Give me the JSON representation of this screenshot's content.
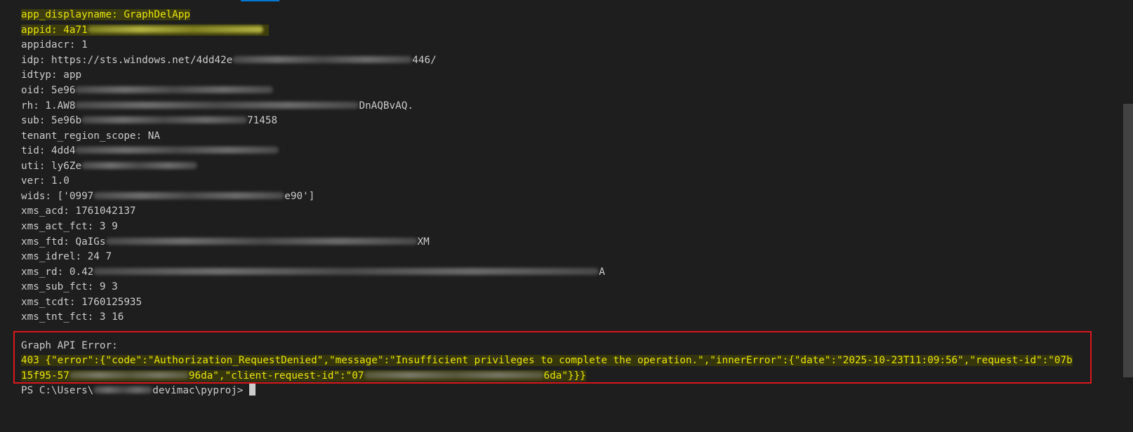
{
  "terminal": {
    "token_lines": [
      {
        "prefix": "app_displayname: GraphDelApp",
        "suffix": "",
        "highlight": true
      },
      {
        "prefix": "appid: 4a71",
        "suffix": "",
        "highlight": true
      },
      {
        "prefix": "appidacr: 1",
        "suffix": "",
        "highlight": false
      },
      {
        "prefix": "idp: https://sts.windows.net/4dd42e",
        "suffix": "446/",
        "highlight": false
      },
      {
        "prefix": "idtyp: app",
        "suffix": "",
        "highlight": false
      },
      {
        "prefix": "oid: 5e96",
        "suffix": "",
        "highlight": false
      },
      {
        "prefix": "rh: 1.AW8",
        "suffix": "DnAQBvAQ.",
        "highlight": false
      },
      {
        "prefix": "sub: 5e96b",
        "suffix": "71458",
        "highlight": false
      },
      {
        "prefix": "tenant_region_scope: NA",
        "suffix": "",
        "highlight": false
      },
      {
        "prefix": "tid: 4dd4",
        "suffix": "",
        "highlight": false
      },
      {
        "prefix": "uti: ly6Ze",
        "suffix": "",
        "highlight": false
      },
      {
        "prefix": "ver: 1.0",
        "suffix": "",
        "highlight": false
      },
      {
        "prefix": "wids: ['0997",
        "suffix": "e90']",
        "highlight": false
      },
      {
        "prefix": "xms_acd: 1761042137",
        "suffix": "",
        "highlight": false
      },
      {
        "prefix": "xms_act_fct: 3 9",
        "suffix": "",
        "highlight": false
      },
      {
        "prefix": "xms_ftd: QaIGs",
        "suffix": "XM",
        "highlight": false
      },
      {
        "prefix": "xms_idrel: 24 7",
        "suffix": "",
        "highlight": false
      },
      {
        "prefix": "xms_rd: 0.42",
        "suffix": "A",
        "highlight": false
      },
      {
        "prefix": "xms_sub_fct: 9 3",
        "suffix": "",
        "highlight": false
      },
      {
        "prefix": "xms_tcdt: 1760125935",
        "suffix": "",
        "highlight": false
      },
      {
        "prefix": "xms_tnt_fct: 3 16",
        "suffix": "",
        "highlight": false
      }
    ],
    "error": {
      "heading": "Graph API Error:",
      "line1": "403 {\"error\":{\"code\":\"Authorization_RequestDenied\",\"message\":\"Insufficient privileges to complete the operation.\",\"innerError\":{\"date\":\"2025-10-23T11:09:56\",\"request-id\":\"07b",
      "line2_a": "15f95-57",
      "line2_b": "96da\",\"client-request-id\":\"07",
      "line2_c": "6da\"}}}"
    },
    "prompt": {
      "prefix": "PS C:\\Users\\",
      "suffix": "devimac\\pyproj> "
    }
  },
  "colors": {
    "background": "#1e1e1e",
    "text": "#cccccc",
    "highlight_text": "#e8e600",
    "error_border": "#d9181b",
    "accent": "#0078d4"
  }
}
